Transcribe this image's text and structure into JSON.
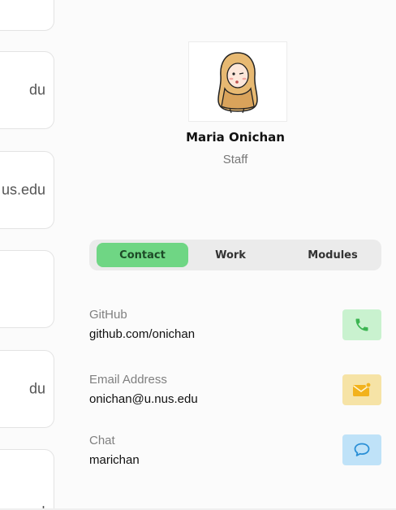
{
  "left_cards": [
    {
      "text": ""
    },
    {
      "text": "du"
    },
    {
      "text": "us.edu"
    },
    {
      "text": ""
    },
    {
      "text": "du"
    },
    {
      "text": "ı"
    }
  ],
  "profile": {
    "name": "Maria Onichan",
    "role": "Staff"
  },
  "tabs": [
    {
      "label": "Contact",
      "active": true
    },
    {
      "label": "Work",
      "active": false
    },
    {
      "label": "Modules",
      "active": false
    }
  ],
  "contacts": [
    {
      "label": "GitHub",
      "value": "github.com/onichan",
      "icon": "phone-icon",
      "color": "#c9f2cf"
    },
    {
      "label": "Email Address",
      "value": "onichan@u.nus.edu",
      "icon": "mail-icon",
      "color": "#f6e3a6"
    },
    {
      "label": "Chat",
      "value": "marichan",
      "icon": "chat-icon",
      "color": "#bfe2f8"
    }
  ],
  "colors": {
    "accent_green": "#6fd684",
    "phone_icon": "#3cb552",
    "mail_icon": "#f2b21c",
    "chat_icon": "#2a8fd6"
  }
}
